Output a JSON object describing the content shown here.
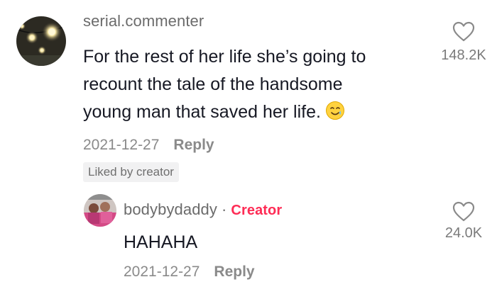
{
  "comment": {
    "username": "serial.commenter",
    "text_lines": [
      "For the rest of her life she’s going to",
      "recount the tale of the handsome",
      "young man that saved her life."
    ],
    "emoji": "smiling-face-with-tear-icon",
    "date": "2021-12-27",
    "reply_label": "Reply",
    "liked_badge": "Liked by creator",
    "like_count": "148.2K"
  },
  "reply": {
    "username": "bodybydaddy",
    "separator": "·",
    "creator_label": "Creator",
    "text": "HAHAHA",
    "date": "2021-12-27",
    "reply_label": "Reply",
    "like_count": "24.0K"
  },
  "colors": {
    "creator_accent": "#fe2c55",
    "text_primary": "#161823",
    "text_secondary": "#8a8a8a"
  }
}
